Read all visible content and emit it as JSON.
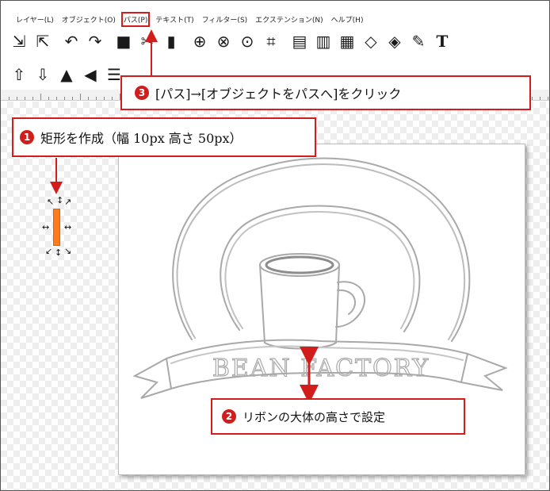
{
  "menu": {
    "items": [
      "レイヤー(L)",
      "オブジェクト(O)",
      "パス(P)",
      "テキスト(T)",
      "フィルター(S)",
      "エクステンション(N)",
      "ヘルプ(H)"
    ],
    "highlighted_index": 2
  },
  "toolbar1": {
    "icons": [
      "import-icon",
      "export-icon",
      "undo-icon",
      "redo-icon",
      "duplicate-icon",
      "cut-icon",
      "paste-icon",
      "zoom-fit-icon",
      "zoom-drawing-icon",
      "zoom-page-icon",
      "select-all-icon",
      "copy-icon",
      "paste-in-place-icon",
      "paste-size-icon",
      "node-editor-icon",
      "path-effects-icon",
      "pen-icon",
      "text-icon"
    ]
  },
  "toolbar2": {
    "icons": [
      "raise-to-top-icon",
      "lower-icon",
      "flip-horizontal-icon",
      "flip-vertical-icon",
      "align-icon",
      "distribute-icon",
      "arrange-icon",
      "transform-icon"
    ]
  },
  "callouts": {
    "step1": {
      "num": "1",
      "text": "矩形を作成（幅 10px 高さ 50px）"
    },
    "step2": {
      "num": "2",
      "text": "リボンの大体の高さで設定"
    },
    "step3": {
      "num": "3",
      "text": "[パス]→[オブジェクトをパスへ]をクリック"
    }
  },
  "drawing": {
    "ribbon_text": "BEAN FACTORY"
  },
  "colors": {
    "callout_red": "#d21d1d",
    "rect_orange": "#ff7a1a"
  }
}
